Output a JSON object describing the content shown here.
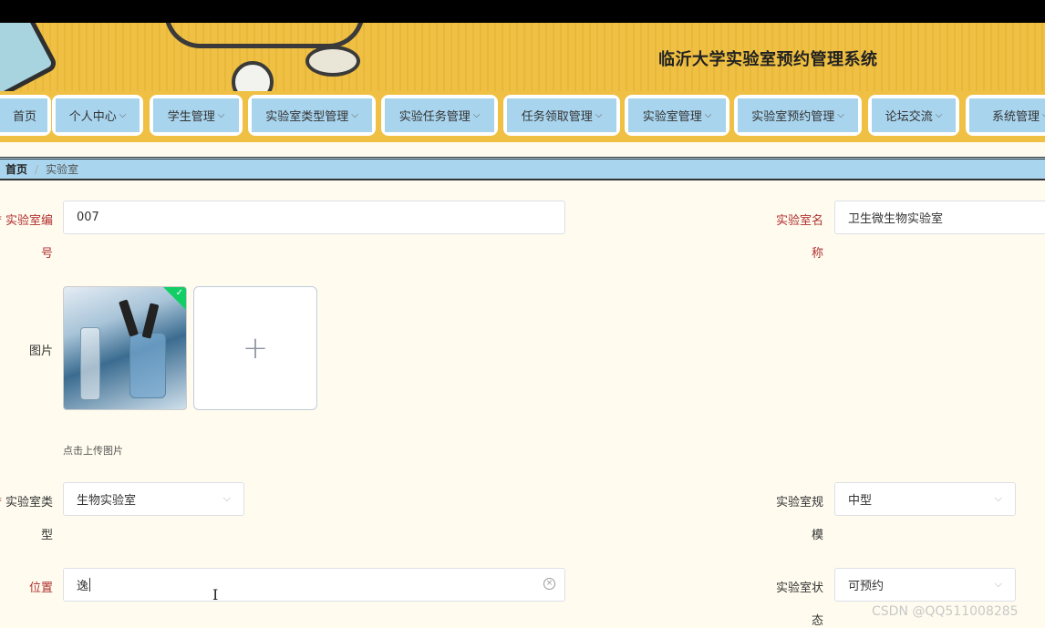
{
  "header": {
    "title": "临沂大学实验室预约管理系统"
  },
  "nav": {
    "items": [
      {
        "label": "首页",
        "has_dropdown": false
      },
      {
        "label": "个人中心",
        "has_dropdown": true
      },
      {
        "label": "学生管理",
        "has_dropdown": true
      },
      {
        "label": "实验室类型管理",
        "has_dropdown": true
      },
      {
        "label": "实验任务管理",
        "has_dropdown": true
      },
      {
        "label": "任务领取管理",
        "has_dropdown": true
      },
      {
        "label": "实验室管理",
        "has_dropdown": true
      },
      {
        "label": "实验室预约管理",
        "has_dropdown": true
      },
      {
        "label": "论坛交流",
        "has_dropdown": true
      },
      {
        "label": "系统管理",
        "has_dropdown": true
      }
    ]
  },
  "breadcrumb": {
    "home": "首页",
    "separator": "/",
    "current": "实验室"
  },
  "form": {
    "lab_number": {
      "label_line1": "实验室编",
      "label_line2": "号",
      "value": "007"
    },
    "lab_name": {
      "label_line1": "实验室名",
      "label_line2": "称",
      "value": "卫生微生物实验室"
    },
    "image": {
      "label": "图片",
      "hint": "点击上传图片",
      "upload_symbol": "+"
    },
    "lab_type": {
      "label_line1": "实验室类",
      "label_line2": "型",
      "value": "生物实验室"
    },
    "lab_scale": {
      "label_line1": "实验室规",
      "label_line2": "模",
      "value": "中型"
    },
    "location": {
      "label": "位置",
      "value": "逸"
    },
    "lab_status": {
      "label_line1": "实验室状",
      "label_line2": "态",
      "value": "可预约"
    },
    "required_mark": "*"
  },
  "watermark": "CSDN @QQ511008285",
  "colors": {
    "banner": "#efc043",
    "nav_item": "#a8d4ee",
    "required_label": "#b03030",
    "page_bg": "#fffcef"
  }
}
